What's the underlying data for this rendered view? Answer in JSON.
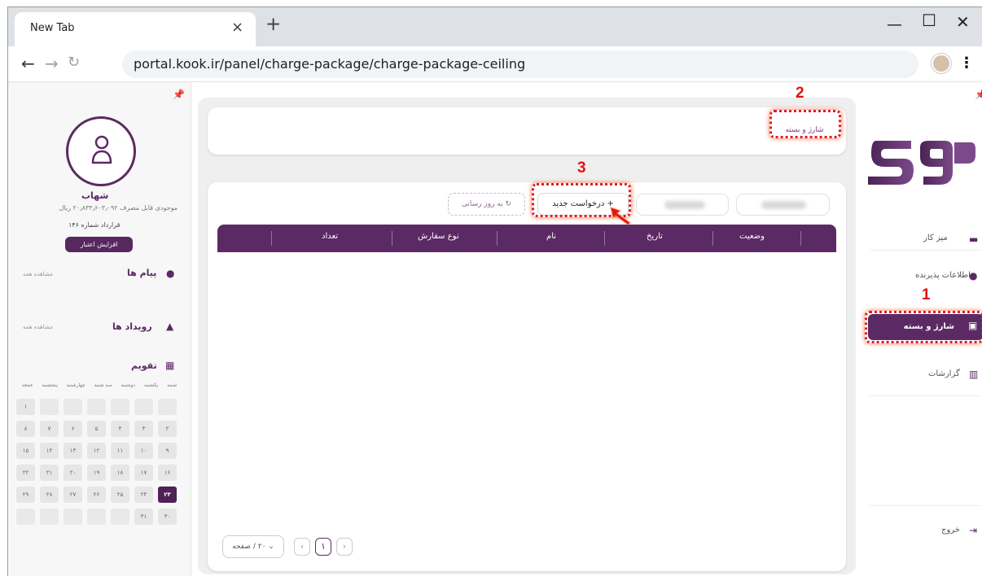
{
  "browser": {
    "tab_title": "New Tab",
    "tab_close": "×",
    "new_tab": "+",
    "minimize": "—",
    "maximize": "☐",
    "close": "✕",
    "url": "portal.kook.ir/panel/charge-package/charge-package-ceiling",
    "menu": "⋮"
  },
  "left": {
    "user_name": "شهاب",
    "balance": "موجودی قابل مصرف ۲۰٫۸۳۳٫۶۰۳٫۰۹۲ ریال",
    "contract": "قرارداد شماره ۱۴۶",
    "credit_button": "افزایش اعتبار",
    "messages_title": "پیام ها",
    "messages_see_all": "مشاهده همه",
    "events_title": "رویداد ها",
    "events_see_all": "مشاهده همه",
    "calendar_title": "تقویم",
    "weekdays": [
      "شنبه",
      "یکشنبه",
      "دوشنبه",
      "سه شنبه",
      "چهارشنبه",
      "پنجشنبه",
      "جمعه"
    ],
    "calendar_days": [
      "",
      "",
      "",
      "",
      "",
      "",
      "۱",
      "۲",
      "۳",
      "۴",
      "۵",
      "۶",
      "۷",
      "۸",
      "۹",
      "۱۰",
      "۱۱",
      "۱۲",
      "۱۳",
      "۱۴",
      "۱۵",
      "۱۶",
      "۱۷",
      "۱۸",
      "۱۹",
      "۲۰",
      "۲۱",
      "۲۲",
      "۲۳",
      "۲۴",
      "۲۵",
      "۲۶",
      "۲۷",
      "۲۸",
      "۲۹",
      "۳۰",
      "۳۱",
      "",
      "",
      "",
      "",
      ""
    ],
    "today": "۲۳"
  },
  "main": {
    "breadcrumb": "شارژ و بسته",
    "refresh_button": "به روز رسانی",
    "new_request_button": "درخواست جدید",
    "columns": [
      "وضعیت",
      "تاریخ",
      "نام",
      "نوع سفارش",
      "تعداد"
    ],
    "page_size": "۲۰ / صفحه",
    "current_page": "۱"
  },
  "right": {
    "menu_dashboard": "میز کار",
    "menu_acceptor_info": "اطلاعات پذیرنده",
    "menu_charge_package": "شارژ و بسته",
    "menu_reports": "گزارشات",
    "menu_logout": "خروج"
  },
  "annotations": [
    "1",
    "2",
    "3"
  ],
  "colors": {
    "brand": "#5b2a64",
    "annotation": "#e3120b"
  }
}
